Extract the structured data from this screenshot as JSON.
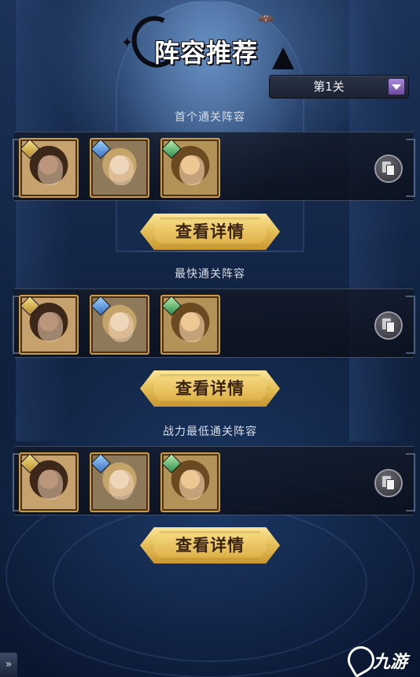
{
  "title": "阵容推荐",
  "level_select": {
    "value": "第1关"
  },
  "teams": [
    {
      "label": "首个通关阵容",
      "detail_button": "查看详情",
      "heroes": [
        {
          "icon": "hero-warrior-woman-portrait",
          "badge": "gold-star-badge"
        },
        {
          "icon": "hero-priestess-portrait",
          "badge": "blue-crystal-badge"
        },
        {
          "icon": "hero-blond-fighter-portrait",
          "badge": "green-crystal-badge"
        }
      ]
    },
    {
      "label": "最快通关阵容",
      "detail_button": "查看详情",
      "heroes": [
        {
          "icon": "hero-warrior-woman-portrait",
          "badge": "gold-star-badge"
        },
        {
          "icon": "hero-priestess-portrait",
          "badge": "blue-crystal-badge"
        },
        {
          "icon": "hero-blond-fighter-portrait",
          "badge": "green-crystal-badge"
        }
      ]
    },
    {
      "label": "战力最低通关阵容",
      "detail_button": "查看详情",
      "heroes": [
        {
          "icon": "hero-warrior-woman-portrait",
          "badge": "gold-star-badge"
        },
        {
          "icon": "hero-priestess-portrait",
          "badge": "blue-crystal-badge"
        },
        {
          "icon": "hero-blond-fighter-portrait",
          "badge": "green-crystal-badge"
        }
      ]
    }
  ],
  "watermark": {
    "text": "九游"
  },
  "colors": {
    "gold_button": "#e7c25c",
    "dropdown_arrow": "#8a6ac0",
    "card_border": "#c99a4a"
  }
}
